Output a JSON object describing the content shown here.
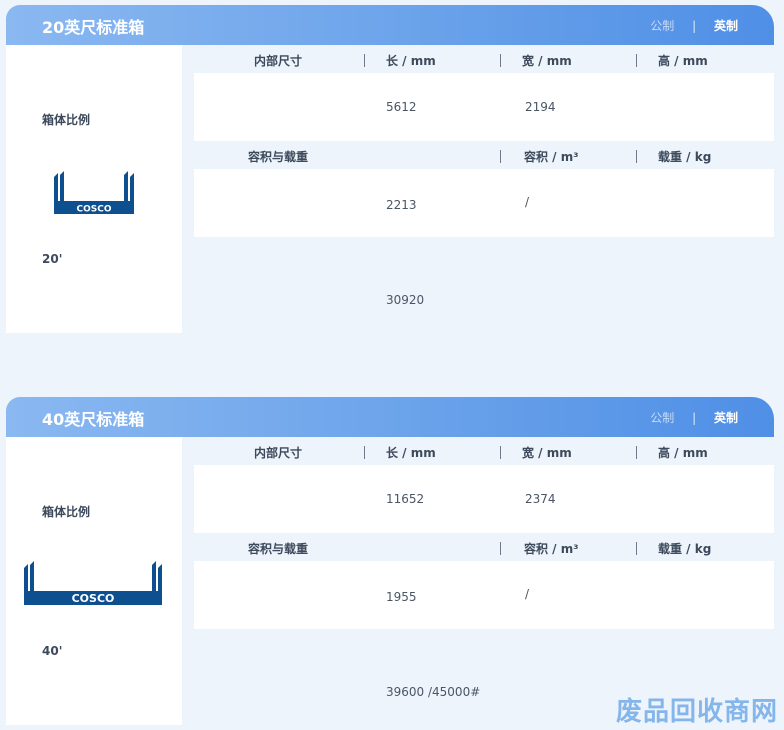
{
  "sections": [
    {
      "title": "20英尺标准箱",
      "unit_metric": "公制",
      "unit_separator": "|",
      "unit_imperial": "英制",
      "ratio_label": "箱体比例",
      "logo_text": "COSCO",
      "size_label": "20'",
      "inner_dims_label": "内部尺寸",
      "length_label": "长 / mm",
      "width_label": "宽 / mm",
      "height_label": "高 / mm",
      "length_value": "5612",
      "width_value": "2194",
      "capacity_label": "容积与载重",
      "volume_label": "容积 / m³",
      "load_label": "载重 / kg",
      "capacity_value": "2213",
      "volume_value": "/",
      "load_value": "30920"
    },
    {
      "title": "40英尺标准箱",
      "unit_metric": "公制",
      "unit_separator": "|",
      "unit_imperial": "英制",
      "ratio_label": "箱体比例",
      "logo_text": "COSCO",
      "size_label": "40'",
      "inner_dims_label": "内部尺寸",
      "length_label": "长 / mm",
      "width_label": "宽 / mm",
      "height_label": "高 / mm",
      "length_value": "11652",
      "width_value": "2374",
      "capacity_label": "容积与载重",
      "volume_label": "容积 / m³",
      "load_label": "载重 / kg",
      "capacity_value": "1955",
      "volume_value": "/",
      "load_value": "39600 /45000#"
    }
  ],
  "watermark": "废品回收商网",
  "colors": {
    "header_start": "#8ab8f1",
    "header_end": "#4f8fe6",
    "logo_blue": "#0d4f8f",
    "background": "#eef4fb"
  }
}
